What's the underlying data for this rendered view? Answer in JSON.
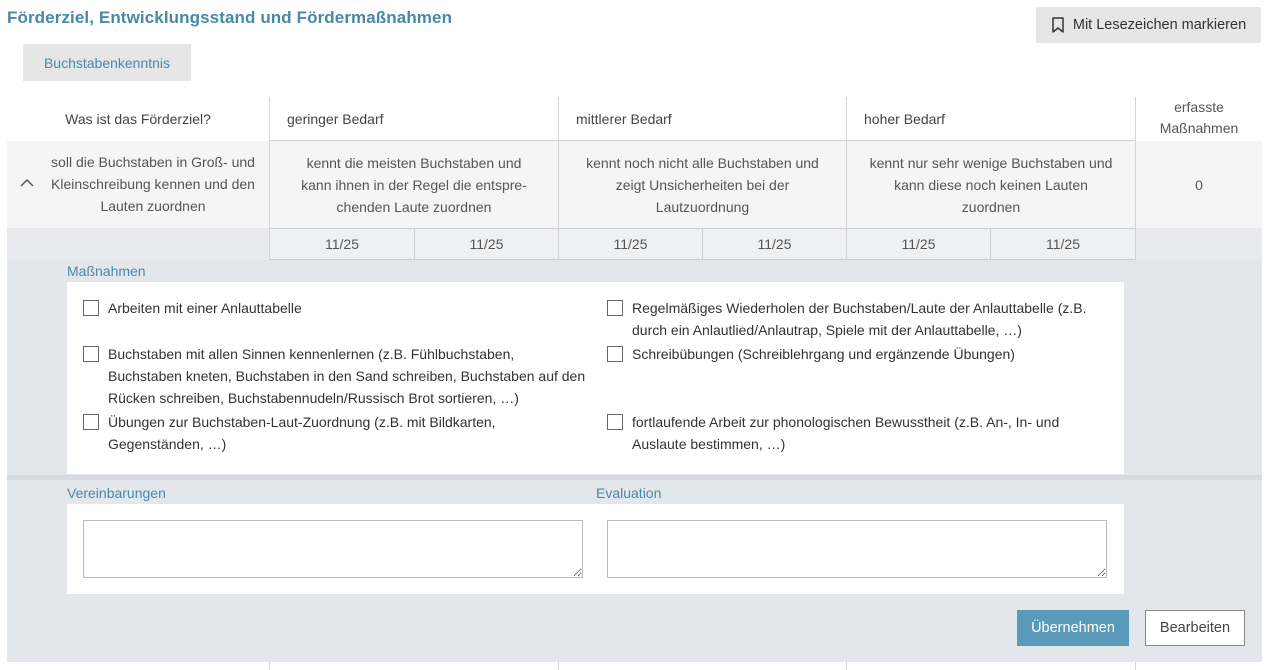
{
  "page": {
    "title": "Förderziel, Entwicklungsstand und Fördermaßnahmen"
  },
  "toolbar": {
    "bookmark_label": "Mit Lesezeichen markieren"
  },
  "tabs": [
    {
      "label": "Buchstabenkenntnis"
    }
  ],
  "table": {
    "question_header": "Was ist das Förderziel?",
    "need_headers": [
      "geringer Bedarf",
      "mittlerer Bedarf",
      "hoher Bedarf"
    ],
    "erfasst_header_line1": "erfasste",
    "erfasst_header_line2": "Maßnahmen",
    "row": {
      "goal_line1": "soll die Buchstaben in Groß- und",
      "goal_line2": "Kleinschreibung kennen und den",
      "goal_line3": "Lauten zuordnen",
      "needs": [
        {
          "line1": "kennt die meisten Buchstaben und",
          "line2": "kann ihnen in der Regel die entspre-",
          "line3": "chenden Laute zuordnen"
        },
        {
          "line1": "kennt noch nicht alle Buchstaben und",
          "line2": "zeigt Unsicherheiten bei der",
          "line3": "Lautzuordnung"
        },
        {
          "line1": "kennt nur sehr wenige Buchstaben und",
          "line2": "kann diese noch keinen Lauten",
          "line3": "zuordnen"
        }
      ],
      "erfasst_count": "0"
    },
    "dates": [
      "11/25",
      "11/25",
      "11/25",
      "11/25",
      "11/25",
      "11/25"
    ]
  },
  "massnahmen": {
    "label": "Maßnahmen",
    "items": [
      {
        "text": "Arbeiten mit einer Anlauttabelle"
      },
      {
        "text": "Regelmäßiges Wiederholen der Buchstaben/Laute der Anlauttabelle (z.B. durch ein Anlautlied/Anlautrap, Spiele mit der Anlauttabelle, …)"
      },
      {
        "text": "Buchstaben mit allen Sinnen kennenlernen (z.B. Fühlbuchstaben, Buchstaben kneten, Buchstaben in den Sand schreiben, Buchstaben auf den Rücken schreiben, Buchstabennudeln/Russisch Brot sortieren, …)"
      },
      {
        "text": "Schreibübungen (Schreiblehrgang und ergänzende Übungen)"
      },
      {
        "text": "Übungen zur Buchstaben-Laut-Zuordnung (z.B. mit Bildkarten, Gegenständen, …)"
      },
      {
        "text": "fortlaufende Arbeit zur phonologischen Bewusstheit (z.B. An-, In- und Auslaute bestimmen, …)"
      }
    ]
  },
  "vereinbarungen": {
    "label": "Vereinbarungen",
    "value": ""
  },
  "evaluation": {
    "label": "Evaluation",
    "value": ""
  },
  "actions": {
    "apply_label": "Übernehmen",
    "edit_label": "Bearbeiten"
  },
  "colors": {
    "accent": "#4a88a8",
    "primary_button": "#5a9ab8",
    "panel_bg": "#e3e6ea"
  }
}
